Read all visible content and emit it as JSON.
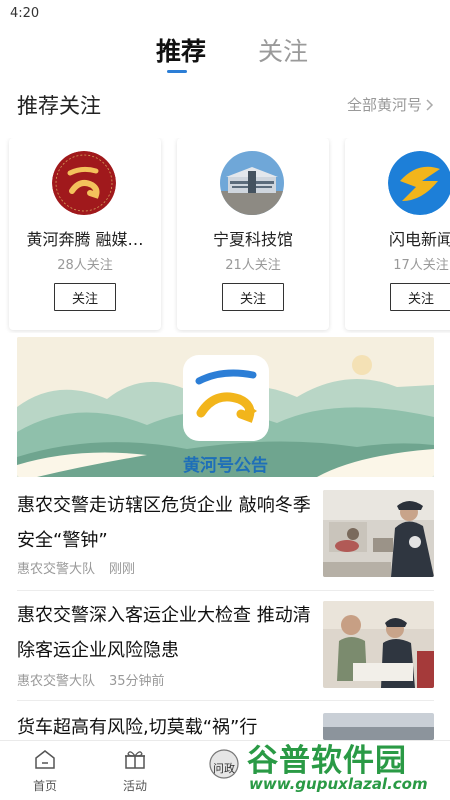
{
  "status_bar": {
    "time": "4:20"
  },
  "top_tabs": {
    "active": "推荐",
    "inactive": "关注",
    "accent": "#2c7ed6"
  },
  "recommend_follow": {
    "title": "推荐关注",
    "more": "全部黄河号",
    "cards": [
      {
        "name": "黄河奔腾 融媒…",
        "count": "28人关注",
        "button": "关注",
        "icon": "yellow-river-logo-icon"
      },
      {
        "name": "宁夏科技馆",
        "count": "21人关注",
        "button": "关注",
        "icon": "science-museum-photo"
      },
      {
        "name": "闪电新闻",
        "count": "17人关注",
        "button": "关注",
        "icon": "lightning-logo-icon"
      }
    ]
  },
  "banner": {
    "label": "黄河号公告"
  },
  "news": [
    {
      "title": "惠农交警走访辖区危货企业 敲响冬季安全“警钟”",
      "source": "惠农交警大队",
      "time": "刚刚"
    },
    {
      "title": "惠农交警深入客运企业大检查 推动清除客运企业风险隐患",
      "source": "惠农交警大队",
      "time": "35分钟前"
    },
    {
      "title": "货车超高有风险,切莫载“祸”行",
      "source": "",
      "time": ""
    }
  ],
  "bottom_nav": {
    "home": "首页",
    "activity": "活动",
    "ask": "问政"
  },
  "watermark": {
    "cn": "谷普软件园",
    "url": "www.gupuxlazal.com"
  }
}
